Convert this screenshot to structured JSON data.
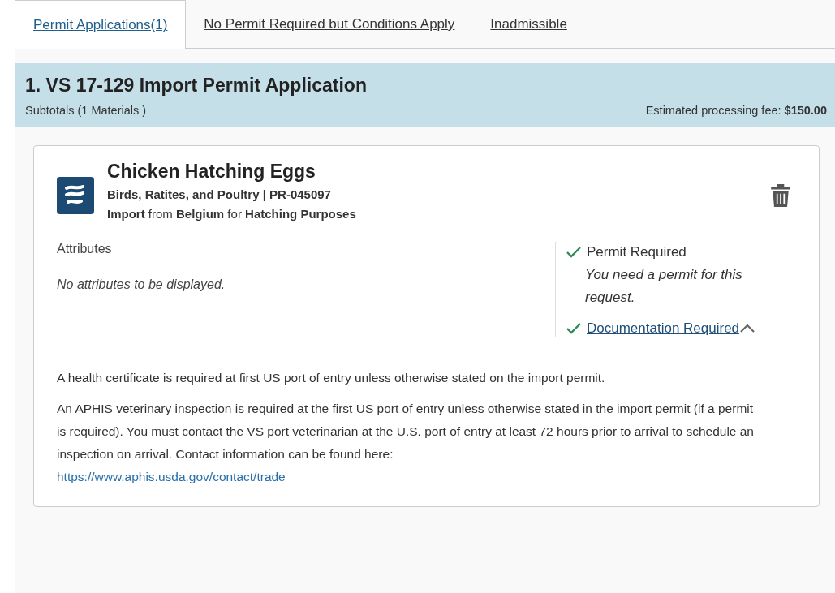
{
  "tabs": [
    {
      "label": "Permit Applications(1)",
      "selected": true
    },
    {
      "label": "No Permit Required but Conditions Apply",
      "selected": false
    },
    {
      "label": "Inadmissible",
      "selected": false
    }
  ],
  "section": {
    "title": "1. VS 17-129 Import Permit Application",
    "subtotals": "Subtotals (1 Materials )",
    "fee": "Estimated processing fee: **$150.00**"
  },
  "material": {
    "name": "Chicken Hatching Eggs",
    "category": "Birds, Ratites, and Poultry | PR-045097",
    "route": "**Import** from **Belgium** for **Hatching Purposes**",
    "attributes_heading": "Attributes",
    "attributes_empty": "No attributes to be displayed.",
    "requirements": [
      {
        "kind": "text",
        "label": "Permit Required",
        "checked": true,
        "note": "You need a permit for this request."
      },
      {
        "kind": "link",
        "label": "Documentation Required",
        "checked": true,
        "expanded": true
      }
    ],
    "documentation": [
      {
        "text": "A health certificate is required at first US port of entry unless otherwise stated on the import permit."
      },
      {
        "text": "An APHIS veterinary inspection is required at the first US port of entry unless otherwise stated in the import permit (if a permit is required). You must contact the VS port veterinarian at the U.S. port of entry at least 72 hours prior to arrival to schedule an inspection on arrival. Contact information can be found here:",
        "link": "https://www.aphis.usda.gov/contact/trade"
      }
    ]
  }
}
